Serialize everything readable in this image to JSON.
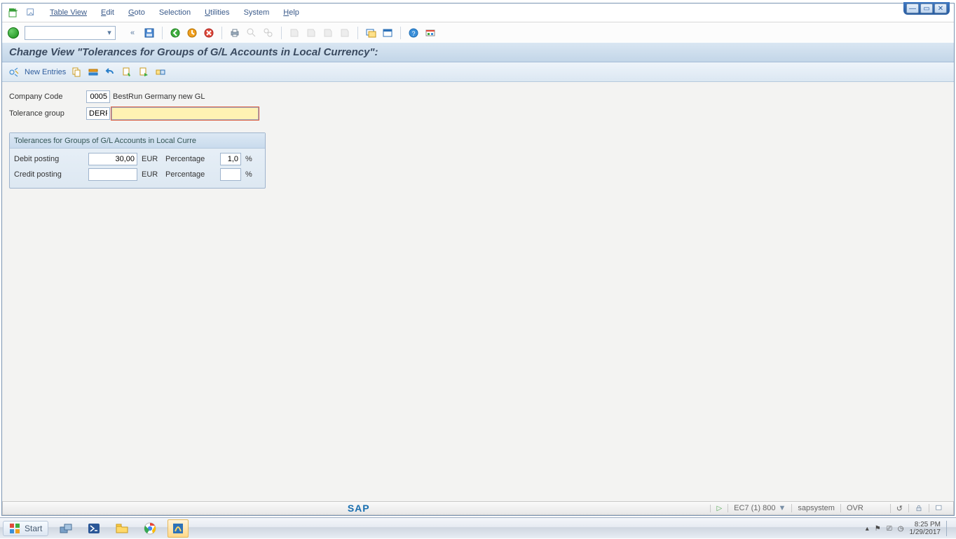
{
  "menu": {
    "table_view": "Table View",
    "edit": "Edit",
    "goto": "Goto",
    "selection": "Selection",
    "utilities": "Utilities",
    "system": "System",
    "help": "Help"
  },
  "title": "Change View \"Tolerances for Groups of G/L Accounts in Local Currency\":",
  "apptb": {
    "new_entries": "New Entries"
  },
  "fields": {
    "company_code_label": "Company Code",
    "company_code_value": "0005",
    "company_code_text": "BestRun Germany new GL",
    "tol_group_label": "Tolerance group",
    "tol_group_value": "DERP",
    "tol_group_text_value": ""
  },
  "group": {
    "title": "Tolerances for Groups of G/L Accounts in Local Curre",
    "debit_label": "Debit posting",
    "debit_value": "30,00",
    "debit_unit": "EUR",
    "debit_pct_label": "Percentage",
    "debit_pct_value": "1,0",
    "debit_pct_unit": "%",
    "credit_label": "Credit posting",
    "credit_value": "",
    "credit_unit": "EUR",
    "credit_pct_label": "Percentage",
    "credit_pct_value": "",
    "credit_pct_unit": "%"
  },
  "status": {
    "sap_logo": "SAP",
    "system": "EC7 (1) 800",
    "host": "sapsystem",
    "mode": "OVR"
  },
  "taskbar": {
    "start": "Start",
    "time": "8:25 PM",
    "date": "1/29/2017"
  }
}
